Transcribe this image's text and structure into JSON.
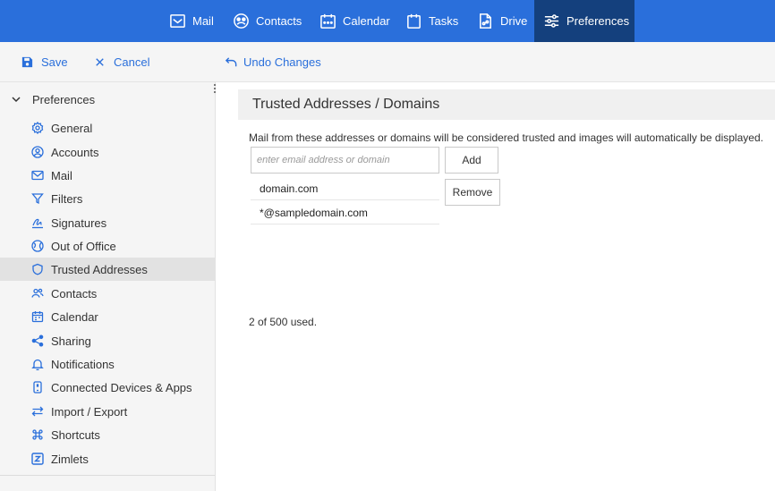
{
  "nav": {
    "tabs": [
      {
        "label": "Mail",
        "icon": "mail-icon"
      },
      {
        "label": "Contacts",
        "icon": "contacts-icon"
      },
      {
        "label": "Calendar",
        "icon": "calendar-icon"
      },
      {
        "label": "Tasks",
        "icon": "tasks-icon"
      },
      {
        "label": "Drive",
        "icon": "drive-icon"
      },
      {
        "label": "Preferences",
        "icon": "preferences-icon",
        "active": true
      }
    ]
  },
  "toolbar": {
    "save_label": "Save",
    "cancel_label": "Cancel",
    "undo_label": "Undo Changes"
  },
  "sidebar": {
    "header": "Preferences",
    "items": [
      {
        "label": "General",
        "icon": "gear-icon"
      },
      {
        "label": "Accounts",
        "icon": "account-icon"
      },
      {
        "label": "Mail",
        "icon": "mail-icon"
      },
      {
        "label": "Filters",
        "icon": "filter-icon"
      },
      {
        "label": "Signatures",
        "icon": "signature-icon"
      },
      {
        "label": "Out of Office",
        "icon": "out-of-office-icon"
      },
      {
        "label": "Trusted Addresses",
        "icon": "shield-icon",
        "active": true
      },
      {
        "label": "Contacts",
        "icon": "contacts-icon"
      },
      {
        "label": "Calendar",
        "icon": "calendar-icon"
      },
      {
        "label": "Sharing",
        "icon": "share-icon"
      },
      {
        "label": "Notifications",
        "icon": "bell-icon"
      },
      {
        "label": "Connected Devices & Apps",
        "icon": "device-icon"
      },
      {
        "label": "Import / Export",
        "icon": "import-export-icon"
      },
      {
        "label": "Shortcuts",
        "icon": "command-icon"
      },
      {
        "label": "Zimlets",
        "icon": "zimlet-icon"
      }
    ]
  },
  "main": {
    "title": "Trusted Addresses / Domains",
    "description": "Mail from these addresses or domains will be considered trusted and images will automatically be displayed.",
    "input_placeholder": "enter email address or domain",
    "input_value": "",
    "add_label": "Add",
    "remove_label": "Remove",
    "addresses": [
      "domain.com",
      "*@sampledomain.com"
    ],
    "usage": "2 of 500 used."
  },
  "colors": {
    "brand": "#2a6fdb",
    "active_tab": "#14407d"
  }
}
